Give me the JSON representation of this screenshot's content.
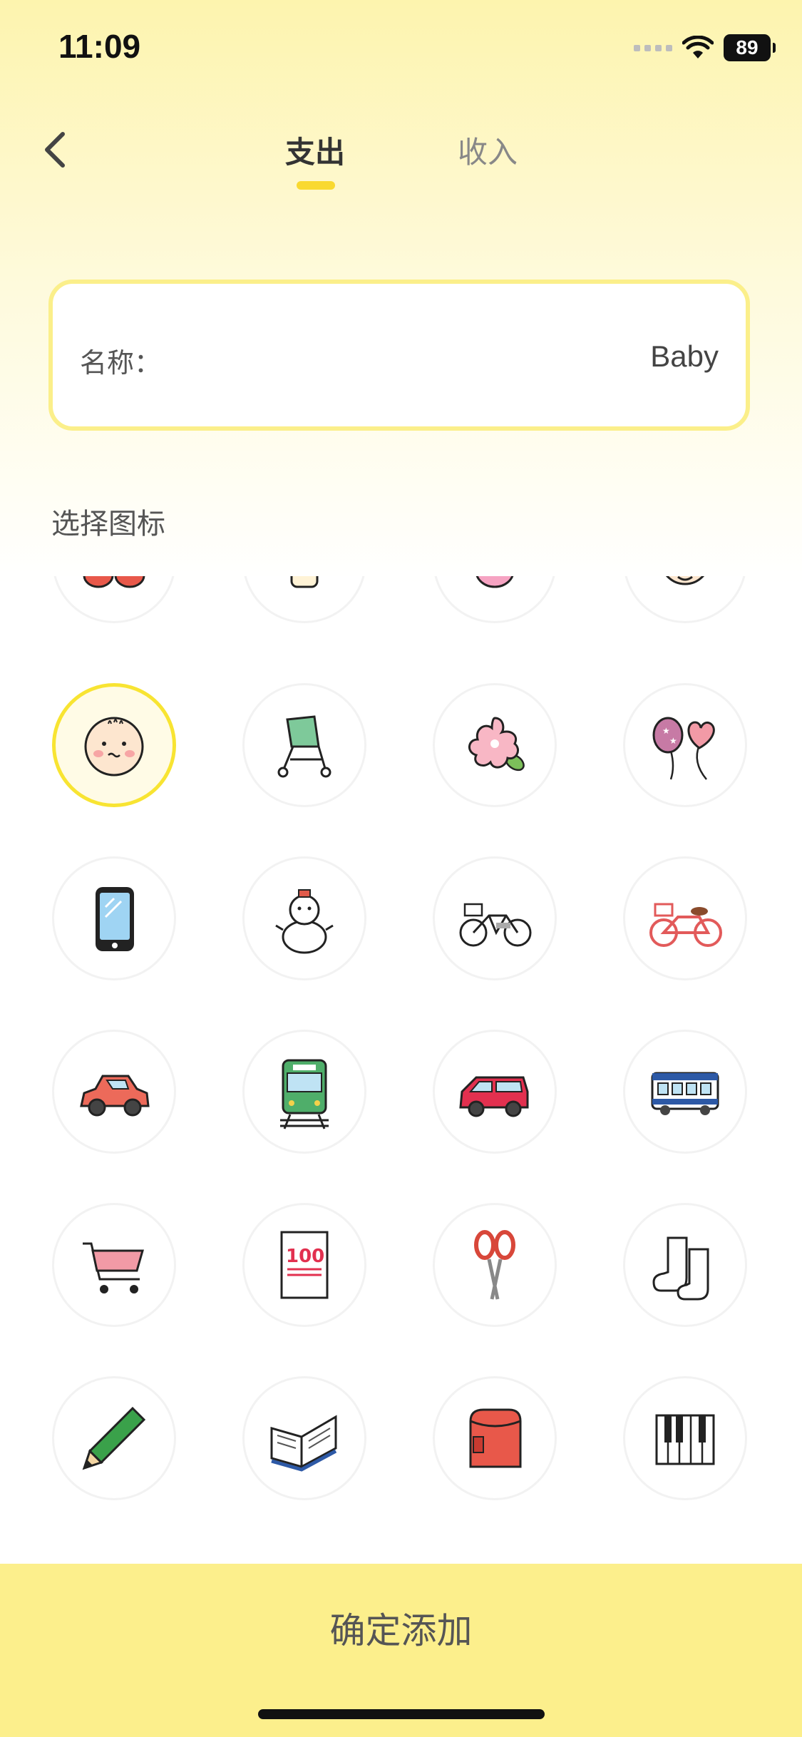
{
  "status": {
    "time": "11:09",
    "battery": "89"
  },
  "nav": {
    "tabs": [
      {
        "label": "支出",
        "active": true
      },
      {
        "label": "收入",
        "active": false
      }
    ]
  },
  "form": {
    "name_label": "名称：",
    "name_value": "Baby"
  },
  "section_title": "选择图标",
  "icons": [
    [
      "baby-shoes-icon",
      "baby-bottle-icon",
      "pink-ball-icon",
      "baby-face-icon"
    ],
    [
      "baby-face-icon",
      "stroller-icon",
      "cherry-blossom-icon",
      "balloons-icon"
    ],
    [
      "smartphone-icon",
      "snowman-icon",
      "bicycle-icon",
      "red-bicycle-icon"
    ],
    [
      "red-car-icon",
      "train-icon",
      "red-minivan-icon",
      "bus-icon"
    ],
    [
      "shopping-cart-icon",
      "test-paper-100-icon",
      "scissors-icon",
      "socks-icon"
    ],
    [
      "pencil-icon",
      "open-book-icon",
      "school-backpack-icon",
      "piano-icon"
    ]
  ],
  "selected_icon": "baby-face-icon",
  "colors": {
    "accent": "#f9d930",
    "bottom_bar": "#fcef8c",
    "selected_ring": "#f8e432"
  },
  "confirm_label": "确定添加"
}
